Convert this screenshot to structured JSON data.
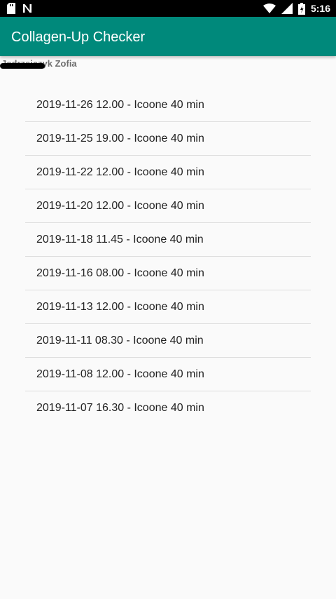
{
  "status_bar": {
    "time": "5:16",
    "icons_left": [
      "sd-card-icon",
      "notification-n-icon"
    ],
    "icons_right": [
      "wifi-icon",
      "signal-icon",
      "battery-icon"
    ]
  },
  "app_bar": {
    "title": "Collagen-Up Checker",
    "color": "#00897b"
  },
  "user": {
    "name": "Jędrzejczyk Zofia"
  },
  "sessions": [
    "2019-11-26 12.00 - Icoone 40 min",
    "2019-11-25 19.00 - Icoone 40 min",
    "2019-11-22 12.00 - Icoone 40 min",
    "2019-11-20 12.00 - Icoone 40 min",
    "2019-11-18 11.45 - Icoone 40 min",
    "2019-11-16 08.00 - Icoone 40 min",
    "2019-11-13 12.00 - Icoone 40 min",
    "2019-11-11 08.30 - Icoone 40 min",
    "2019-11-08 12.00 - Icoone 40 min",
    "2019-11-07 16.30 - Icoone 40 min"
  ]
}
